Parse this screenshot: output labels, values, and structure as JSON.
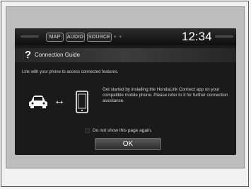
{
  "header": {
    "tabs": [
      {
        "label": "MAP"
      },
      {
        "label": "AUDIO"
      },
      {
        "label": "SOURCE"
      }
    ],
    "status_text": "■ ◦ ■",
    "clock": "12:34"
  },
  "dialog": {
    "icon": "question-icon",
    "title": "Connection Guide",
    "intro": "Link with your phone to access connected features.",
    "body": "Get started by installing the HondaLink Connect app on your compatible mobile phone. Please refer to it for further connection assistance.",
    "checkbox_label": "Do not show this page again.",
    "checkbox_checked": false,
    "ok_label": "OK"
  },
  "icons": {
    "car": "car-icon",
    "arrow": "double-arrow-icon",
    "phone": "smartphone-icon"
  },
  "colors": {
    "screen_background": "#1a1a1a",
    "page_frame": "#bdbdbd",
    "text": "#d6d6d6",
    "clock": "#ffffff"
  }
}
